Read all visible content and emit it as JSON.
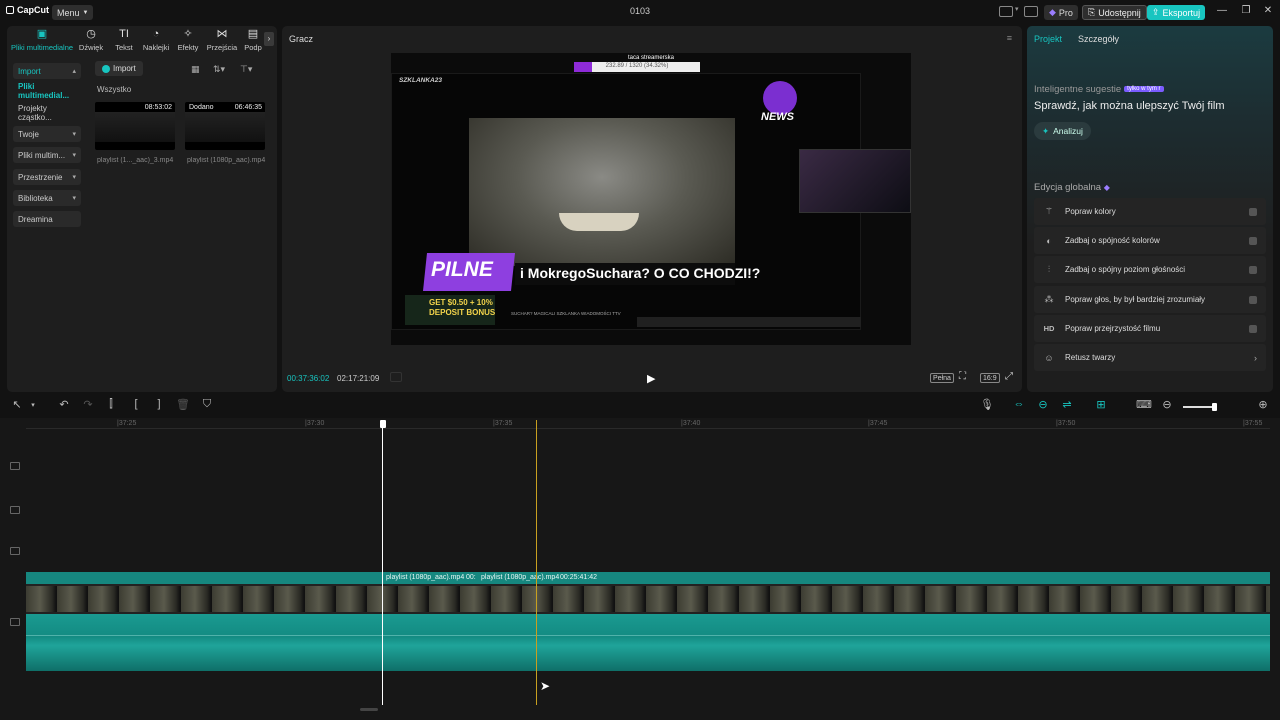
{
  "app": {
    "logo": "CapCut",
    "menu_label": "Menu",
    "project_name": "0103"
  },
  "titlebar": {
    "pro_label": "Pro",
    "share_label": "Udostępnij",
    "export_label": "Eksportuj"
  },
  "colors": {
    "accent": "#18c5c0",
    "purple": "#7b5cff",
    "panel": "#1e1e1e"
  },
  "media": {
    "tabs": [
      {
        "label": "Pliki multimedialne",
        "icon": "media-icon"
      },
      {
        "label": "Dźwięk",
        "icon": "audio-icon"
      },
      {
        "label": "Tekst",
        "icon": "text-icon"
      },
      {
        "label": "Naklejki",
        "icon": "sticker-icon"
      },
      {
        "label": "Efekty",
        "icon": "effects-icon"
      },
      {
        "label": "Przejścia",
        "icon": "transition-icon"
      },
      {
        "label": "Podp",
        "icon": "captions-icon"
      }
    ],
    "sidebar": [
      "Import",
      "Pliki multimedial...",
      "Projekty cząstko...",
      "Twoje",
      "Pliki multim...",
      "Przestrzenie",
      "Biblioteka",
      "Dreamina"
    ],
    "import_label": "Import",
    "all_label": "Wszystko",
    "items": [
      {
        "duration": "08:53:02",
        "caption": "playlist (1..._aac)_3.mp4",
        "badge": ""
      },
      {
        "duration": "06:46:35",
        "caption": "playlist (1080p_aac).mp4",
        "badge": "Dodano"
      }
    ]
  },
  "player": {
    "title": "Gracz",
    "current_time": "00:37:36:02",
    "total_time": "02:17:21:09",
    "ratio_label": "Pełna",
    "aspect_label": "16:9",
    "video": {
      "top_label": "taca streamerska",
      "progress_text": "232.89 / 1320 (34.32%)",
      "channel": "SZKLANKA23",
      "news_label": "NEWS",
      "pilne_label": "PILNE",
      "headline": "i MokregoSuchara? O CO CHODZI!?",
      "ad_top": "GET $0.50 + 10%",
      "ad_bottom": "DEPOSIT BONUS",
      "ticker": "SUCHAR? MAGICALI SZKLANKA WIADOMOŚCI TTV"
    }
  },
  "properties": {
    "tabs": [
      "Projekt",
      "Szczegóły"
    ],
    "smart_title": "Inteligentne sugestie",
    "smart_badge": "tylko w tym r",
    "smart_desc": "Sprawdź, jak można ulepszyć Twój film",
    "analyze_label": "Analizuj",
    "global_title": "Edycja globalna",
    "options": [
      {
        "label": "Popraw kolory",
        "icon": "magic-wand-icon"
      },
      {
        "label": "Zadbaj o spójność kolorów",
        "icon": "color-match-icon"
      },
      {
        "label": "Zadbaj o spójny poziom głośności",
        "icon": "volume-level-icon"
      },
      {
        "label": "Popraw głos, by był bardziej zrozumiały",
        "icon": "voice-enhance-icon"
      },
      {
        "label": "Popraw przejrzystość filmu",
        "icon": "hd-icon"
      },
      {
        "label": "Retusz twarzy",
        "icon": "face-retouch-icon"
      }
    ]
  },
  "timeline": {
    "ruler": [
      "|37:25",
      "|37:30",
      "|37:35",
      "|37:40",
      "|37:45",
      "|37:50",
      "|37:55"
    ],
    "clip1_label": "playlist (1080p_aac).mp4",
    "clip_mid": "00:",
    "clip2_label": "playlist (1080p_aac).mp4",
    "clip2_duration": "00:25:41:42"
  }
}
